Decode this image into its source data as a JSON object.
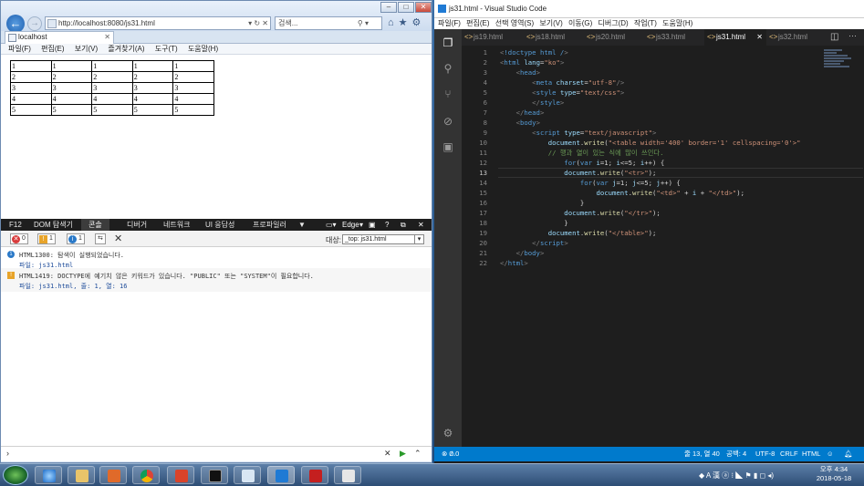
{
  "ie": {
    "address": "http://localhost:8080/js31.html",
    "search_placeholder": "검색...",
    "tab_title": "localhost",
    "menu": [
      "파일(F)",
      "편집(E)",
      "보기(V)",
      "즐겨찾기(A)",
      "도구(T)",
      "도움말(H)"
    ],
    "table_rows": [
      [
        "1",
        "1",
        "1",
        "1",
        "1"
      ],
      [
        "2",
        "2",
        "2",
        "2",
        "2"
      ],
      [
        "3",
        "3",
        "3",
        "3",
        "3"
      ],
      [
        "4",
        "4",
        "4",
        "4",
        "4"
      ],
      [
        "5",
        "5",
        "5",
        "5",
        "5"
      ]
    ],
    "devtools_tabs": [
      "F12",
      "DOM 탐색기",
      "콘솔",
      "디버거",
      "네트워크",
      "UI 응답성",
      "프로파일러"
    ],
    "devtools_mode": "Edge",
    "count_error": "0",
    "count_warn": "1",
    "count_info": "1",
    "target_label": "대상:",
    "target_value": "_top: js31.html",
    "messages": [
      {
        "line1": "HTML1300: 탐색이 실행되었습니다.",
        "line2": "파일: js31.html"
      },
      {
        "line1": "HTML1419: DOCTYPE에 예기치 않은 키워드가 있습니다. \"PUBLIC\" 또는 \"SYSTEM\"이 필요합니다.",
        "line2": "파일: js31.html, 줄: 1, 열: 16"
      }
    ]
  },
  "vscode": {
    "title": "js31.html - Visual Studio Code",
    "menu": [
      "파일(F)",
      "편집(E)",
      "선택 영역(S)",
      "보기(V)",
      "이동(G)",
      "디버그(D)",
      "작업(T)",
      "도움말(H)"
    ],
    "tabs": [
      "js19.html",
      "js18.html",
      "js20.html",
      "js33.html",
      "js31.html",
      "js32.html"
    ],
    "active_tab": "js31.html",
    "status": {
      "errors": "0",
      "warnings": "0",
      "position": "줄 13, 열 40",
      "spaces": "공백: 4",
      "encoding": "UTF-8",
      "eol": "CRLF",
      "lang": "HTML"
    }
  },
  "clock": {
    "time": "오후 4:34",
    "date": "2018-05-18"
  }
}
